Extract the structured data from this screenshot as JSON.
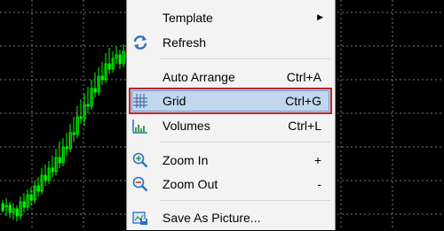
{
  "chart": {
    "background": "#000000",
    "grid_color": "#7a7a7a",
    "bull_color": "#00ff00",
    "candles": [
      [
        230,
        238,
        226,
        240
      ],
      [
        234,
        232,
        224,
        244
      ],
      [
        232,
        240,
        228,
        246
      ],
      [
        240,
        236,
        230,
        248
      ],
      [
        236,
        244,
        232,
        250
      ],
      [
        244,
        228,
        222,
        248
      ],
      [
        228,
        234,
        218,
        240
      ],
      [
        234,
        220,
        214,
        238
      ],
      [
        220,
        226,
        212,
        232
      ],
      [
        226,
        210,
        204,
        230
      ],
      [
        210,
        216,
        200,
        222
      ],
      [
        216,
        198,
        190,
        220
      ],
      [
        198,
        204,
        186,
        210
      ],
      [
        204,
        190,
        182,
        208
      ],
      [
        190,
        194,
        176,
        200
      ],
      [
        194,
        178,
        168,
        198
      ],
      [
        178,
        184,
        160,
        190
      ],
      [
        184,
        166,
        156,
        188
      ],
      [
        166,
        168,
        150,
        176
      ],
      [
        168,
        150,
        140,
        172
      ],
      [
        150,
        152,
        132,
        160
      ],
      [
        152,
        132,
        120,
        156
      ],
      [
        132,
        134,
        112,
        140
      ],
      [
        134,
        118,
        106,
        142
      ],
      [
        118,
        120,
        98,
        128
      ],
      [
        120,
        100,
        90,
        124
      ],
      [
        100,
        104,
        82,
        110
      ],
      [
        104,
        86,
        76,
        108
      ],
      [
        86,
        90,
        70,
        96
      ],
      [
        90,
        72,
        60,
        94
      ],
      [
        72,
        78,
        54,
        84
      ],
      [
        78,
        66,
        58,
        82
      ],
      [
        66,
        62,
        52,
        72
      ],
      [
        62,
        72,
        56,
        78
      ],
      [
        72,
        58,
        50,
        76
      ],
      [
        58,
        64,
        48,
        68
      ]
    ]
  },
  "menu": {
    "items": [
      {
        "label": "Template",
        "submenu": true,
        "icon": "none"
      },
      {
        "label": "Refresh",
        "icon": "refresh-icon"
      },
      {
        "label": "Auto Arrange",
        "shortcut": "Ctrl+A",
        "icon": "none"
      },
      {
        "label": "Grid",
        "shortcut": "Ctrl+G",
        "icon": "grid-icon",
        "selected": true
      },
      {
        "label": "Volumes",
        "shortcut": "Ctrl+L",
        "icon": "volumes-icon"
      },
      {
        "label": "Zoom In",
        "shortcut": "+",
        "icon": "zoom-in-icon"
      },
      {
        "label": "Zoom Out",
        "shortcut": "-",
        "icon": "zoom-out-icon"
      },
      {
        "label": "Save As Picture...",
        "icon": "save-picture-icon"
      }
    ]
  }
}
